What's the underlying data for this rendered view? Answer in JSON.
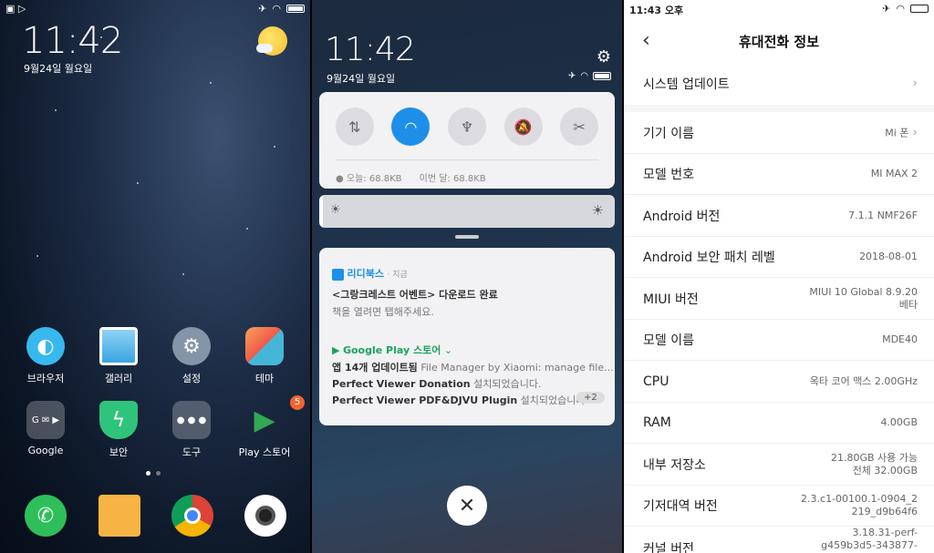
{
  "home": {
    "clock": "11:42",
    "date": "9월24일 월요일",
    "apps": [
      {
        "label": "브라우저"
      },
      {
        "label": "갤러리"
      },
      {
        "label": "설정"
      },
      {
        "label": "테마"
      },
      {
        "label": "Google"
      },
      {
        "label": "보안"
      },
      {
        "label": "도구"
      },
      {
        "label": "Play 스토어",
        "badge": "5"
      }
    ]
  },
  "shade": {
    "clock": "11:42",
    "date": "9월24일 월요일",
    "data_today": "오늘: 68.8KB",
    "data_month": "이번 달: 68.8KB",
    "notif1": {
      "app": "리디북스",
      "time": "· 지금",
      "title": "<그랑크레스트 어벤트> 다운로드 완료",
      "body": "책을 열려면 탭해주세요."
    },
    "notif2": {
      "app": "Google Play 스토어",
      "title": "앱 14개 업데이트됨",
      "title_extra": "File Manager by Xiaomi: manage file...",
      "line2a": "Perfect Viewer Donation",
      "line2b": "설치되었습니다.",
      "line3a": "Perfect Viewer PDF&DJVU Plugin",
      "line3b": "설치되었습니다.",
      "more": "+2"
    }
  },
  "about": {
    "status_time": "11:43 오후",
    "title": "휴대전화 정보",
    "rows": [
      {
        "label": "시스템 업데이트",
        "value": ""
      },
      {
        "label": "기기 이름",
        "value": "Mi 폰"
      },
      {
        "label": "모델 번호",
        "value": "MI MAX 2"
      },
      {
        "label": "Android 버전",
        "value": "7.1.1 NMF26F"
      },
      {
        "label": "Android 보안 패치 레벨",
        "value": "2018-08-01"
      },
      {
        "label": "MIUI 버전",
        "value": "MIUI 10 Global 8.9.20",
        "value2": "베타"
      },
      {
        "label": "모델 이름",
        "value": "MDE40"
      },
      {
        "label": "CPU",
        "value": "옥타 코어 맥스 2.00GHz"
      },
      {
        "label": "RAM",
        "value": "4.00GB"
      },
      {
        "label": "내부 저장소",
        "value": "21.80GB 사용 가능",
        "value2": "전체 32.00GB"
      },
      {
        "label": "기저대역 버전",
        "value": "2.3.c1-00100.1-0904_2",
        "value2": "219_d9b64f6"
      },
      {
        "label": "커널 버전",
        "value": "3.18.31-perf-",
        "value2": "g459b3d5-343877-"
      }
    ]
  }
}
